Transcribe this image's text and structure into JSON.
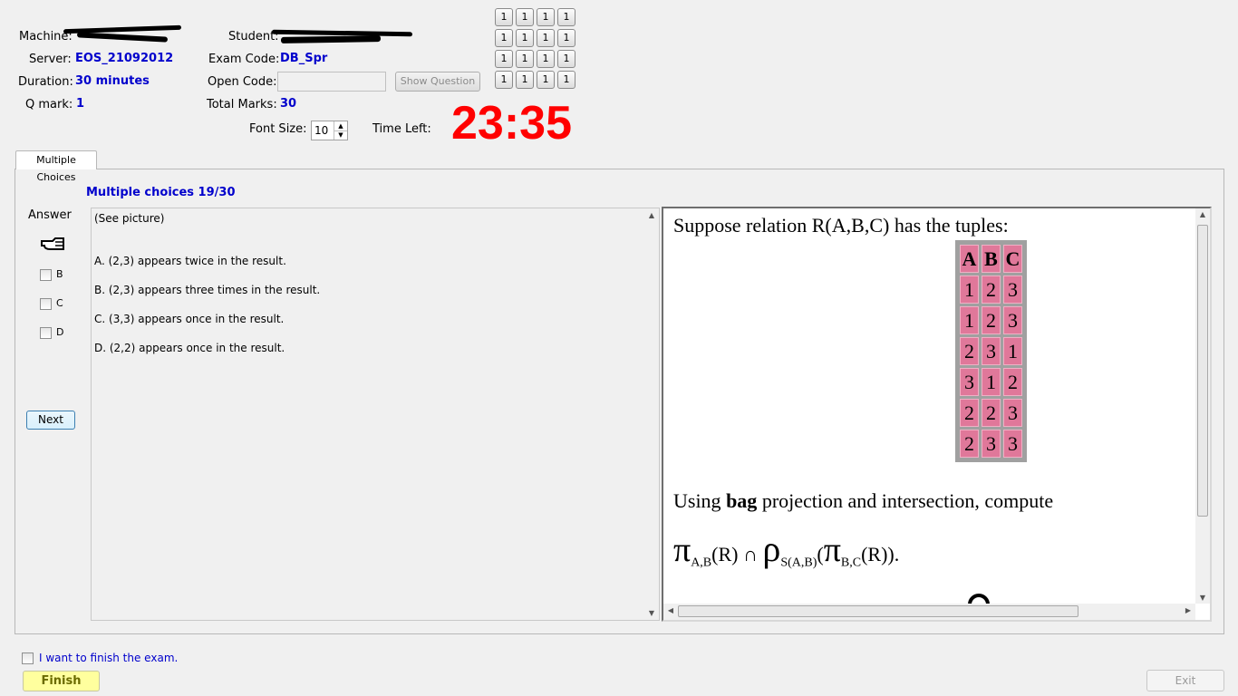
{
  "header": {
    "machine_label": "Machine:",
    "student_label": "Student:",
    "server_label": "Server:",
    "server_value": "EOS_21092012",
    "exam_code_label": "Exam Code:",
    "exam_code_value": "DB_Spr",
    "duration_label": "Duration:",
    "duration_value": "30 minutes",
    "open_code_label": "Open Code:",
    "open_code_value": "",
    "show_question_label": "Show Question",
    "q_mark_label": "Q mark:",
    "q_mark_value": "1",
    "total_marks_label": "Total Marks:",
    "total_marks_value": "30",
    "font_size_label": "Font Size:",
    "font_size_value": "10",
    "time_left_label": "Time Left:",
    "timer": "23:35",
    "timer_color": "#ff0000"
  },
  "grid_buttons": [
    [
      "1",
      "1",
      "1",
      "1"
    ],
    [
      "1",
      "1",
      "1",
      "1"
    ],
    [
      "1",
      "1",
      "1",
      "1"
    ],
    [
      "1",
      "1",
      "1",
      "1"
    ]
  ],
  "tabs": [
    {
      "label": "Multiple Choices"
    }
  ],
  "main": {
    "section_title": "Multiple choices 19/30",
    "answer_label": "Answer",
    "options": [
      "B",
      "C",
      "D"
    ],
    "next_label": "Next",
    "question_intro": "(See picture)",
    "answers": [
      "A.  (2,3) appears twice in the result.",
      "B.  (2,3) appears three times in the result.",
      "C.  (3,3) appears once in the result.",
      "D.  (2,2) appears once in the result."
    ]
  },
  "picture": {
    "line1": "Suppose relation R(A,B,C) has the tuples:",
    "table_header": [
      "A",
      "B",
      "C"
    ],
    "table_rows": [
      [
        "1",
        "2",
        "3"
      ],
      [
        "1",
        "2",
        "3"
      ],
      [
        "2",
        "3",
        "1"
      ],
      [
        "3",
        "1",
        "2"
      ],
      [
        "2",
        "2",
        "3"
      ],
      [
        "2",
        "3",
        "3"
      ]
    ],
    "line2_pre": "Using ",
    "line2_bold": "bag",
    "line2_post": " projection and intersection, compute",
    "pi": "π",
    "sub1": "A,B",
    "r1": "(R) ∩ ",
    "rho": "ρ",
    "sub2": "S(A,B)",
    "paren": "(",
    "sub3": "B,C",
    "r2": "(R)).",
    "cell_color": "#e0789a"
  },
  "footer": {
    "finish_check_label": "I want to finish the exam.",
    "finish_label": "Finish",
    "exit_label": "Exit"
  }
}
